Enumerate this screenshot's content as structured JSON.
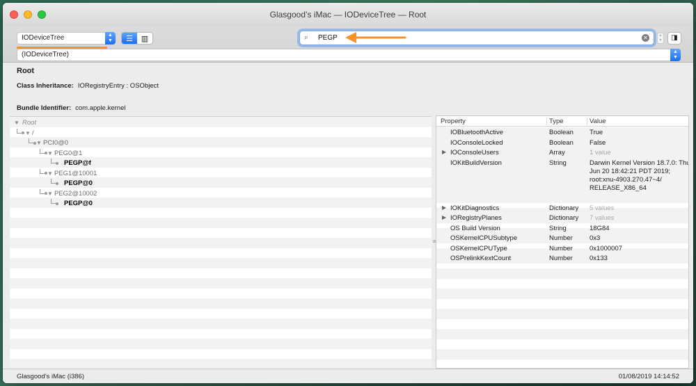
{
  "window": {
    "title": "Glasgood’s iMac — IODeviceTree — Root"
  },
  "toolbar": {
    "plane_select": "IODeviceTree",
    "path_select": "(IODeviceTree)",
    "search_value": "PEGP",
    "accent_color": "#f5922a"
  },
  "info": {
    "name": "Root",
    "class_label": "Class Inheritance:",
    "class_value": "IORegistryEntry : OSObject",
    "bundle_label": "Bundle Identifier:",
    "bundle_value": "com.apple.kernel"
  },
  "tree": {
    "rows": [
      {
        "label": "Root",
        "style": "italic"
      },
      {
        "label": "/",
        "style": "normal"
      },
      {
        "label": "PCI0@0",
        "style": "normal"
      },
      {
        "label": "PEG0@1",
        "style": "normal"
      },
      {
        "label": "PEGP@f",
        "style": "bold"
      },
      {
        "label": "PEG1@10001",
        "style": "normal"
      },
      {
        "label": "PEGP@0",
        "style": "bold"
      },
      {
        "label": "PEG2@10002",
        "style": "normal"
      },
      {
        "label": "PEGP@0",
        "style": "bold"
      }
    ]
  },
  "properties": {
    "headers": {
      "property": "Property",
      "type": "Type",
      "value": "Value"
    },
    "rows": [
      {
        "property": "IOBluetoothActive",
        "type": "Boolean",
        "value": "True",
        "expandable": false,
        "dim": false
      },
      {
        "property": "IOConsoleLocked",
        "type": "Boolean",
        "value": "False",
        "expandable": false,
        "dim": false
      },
      {
        "property": "IOConsoleUsers",
        "type": "Array",
        "value": "1 value",
        "expandable": true,
        "dim": true
      },
      {
        "property": "IOKitBuildVersion",
        "type": "String",
        "value": "Darwin Kernel Version 18.7.0: Thu Jun 20 18:42:21 PDT 2019; root:xnu-4903.270.47~4/ RELEASE_X86_64",
        "expandable": false,
        "dim": false
      },
      {
        "property": "IOKitDiagnostics",
        "type": "Dictionary",
        "value": "5 values",
        "expandable": true,
        "dim": true
      },
      {
        "property": "IORegistryPlanes",
        "type": "Dictionary",
        "value": "7 values",
        "expandable": true,
        "dim": true
      },
      {
        "property": "OS Build Version",
        "type": "String",
        "value": "18G84",
        "expandable": false,
        "dim": false
      },
      {
        "property": "OSKernelCPUSubtype",
        "type": "Number",
        "value": "0x3",
        "expandable": false,
        "dim": false
      },
      {
        "property": "OSKernelCPUType",
        "type": "Number",
        "value": "0x1000007",
        "expandable": false,
        "dim": false
      },
      {
        "property": "OSPrelinkKextCount",
        "type": "Number",
        "value": "0x133",
        "expandable": false,
        "dim": false
      }
    ]
  },
  "status": {
    "machine": "Glasgood’s iMac (i386)",
    "datetime": "01/08/2019 14:14:52"
  }
}
